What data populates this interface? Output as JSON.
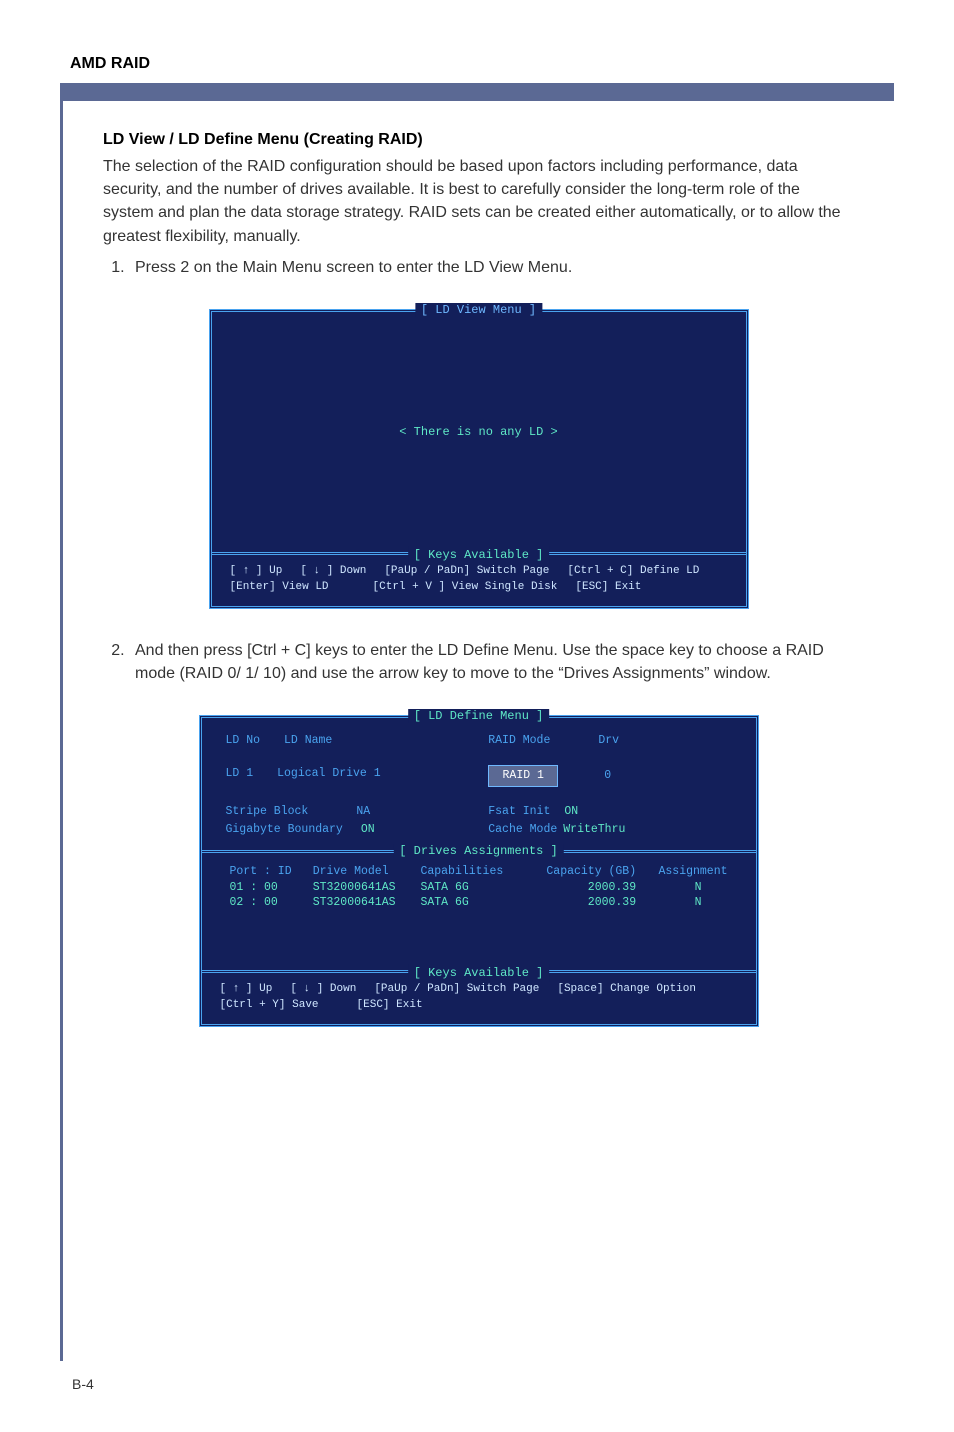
{
  "header": {
    "title": "AMD RAID"
  },
  "section": {
    "heading": "LD View / LD Define Menu (Creating RAID)",
    "intro": "The selection of the RAID configuration should be based upon factors including performance, data security, and the number of drives available. It is best to carefully consider the long-term role of the system and plan the data storage strategy. RAID sets can be created either automatically, or to allow the greatest flexibility, manually.",
    "step1": "Press 2 on the Main Menu screen to enter the LD View Menu.",
    "step2": "And then press [Ctrl + C] keys to enter the LD Define Menu. Use the space key to choose a RAID mode (RAID 0/ 1/ 10) and use the arrow key to move to the “Drives Assignments” window."
  },
  "bios_view": {
    "title": "[  LD View Menu  ]",
    "empty_msg": "<  There is no any LD  >",
    "keys_title": "[ Keys Available ]",
    "keys": {
      "r1a": "[ ↑ ] Up",
      "r1b": "[ ↓ ] Down",
      "r1c": "[PaUp / PaDn]  Switch Page",
      "r1d": "[Ctrl + C]  Define LD",
      "r2a": "[Enter]  View LD",
      "r2b": "[Ctrl + V ]  View  Single  Disk",
      "r2c": "[ESC]  Exit"
    }
  },
  "bios_define": {
    "title": "[  LD Define Menu  ]",
    "labels": {
      "ld_no": "LD  No",
      "ld_name": "LD  Name",
      "raid_mode": "RAID  Mode",
      "drv": "Drv",
      "ld_row": "LD    1",
      "ld_row_name": "Logical  Drive  1",
      "raid_val": "RAID  1",
      "drv_val": "0",
      "stripe": "Stripe  Block",
      "stripe_val": "NA",
      "gig": "Gigabyte  Boundary",
      "gig_val": "ON",
      "fsat": "Fsat  Init",
      "fsat_val": "ON",
      "cache": "Cache Mode",
      "cache_val": "WriteThru"
    },
    "drives_title": "[  Drives Assignments  ]",
    "drives_headers": {
      "port": "Port  :  ID",
      "model": "Drive  Model",
      "cap": "Capabilities",
      "capacity": "Capacity (GB)",
      "assign": "Assignment"
    },
    "drives_rows": [
      {
        "port": "01 : 00",
        "model": "ST32000641AS",
        "cap": "SATA  6G",
        "capacity": "2000.39",
        "assign": "N"
      },
      {
        "port": "02 : 00",
        "model": "ST32000641AS",
        "cap": "SATA  6G",
        "capacity": "2000.39",
        "assign": "N"
      }
    ],
    "keys_title": "[ Keys Available ]",
    "keys": {
      "r1a": "[ ↑ ] Up",
      "r1b": "[ ↓ ] Down",
      "r1c": "[PaUp / PaDn]  Switch Page",
      "r1d": "[Space]  Change Option",
      "r2a": "[Ctrl + Y]  Save",
      "r2b": "[ESC]  Exit"
    }
  },
  "footer": {
    "page": "B-4"
  }
}
